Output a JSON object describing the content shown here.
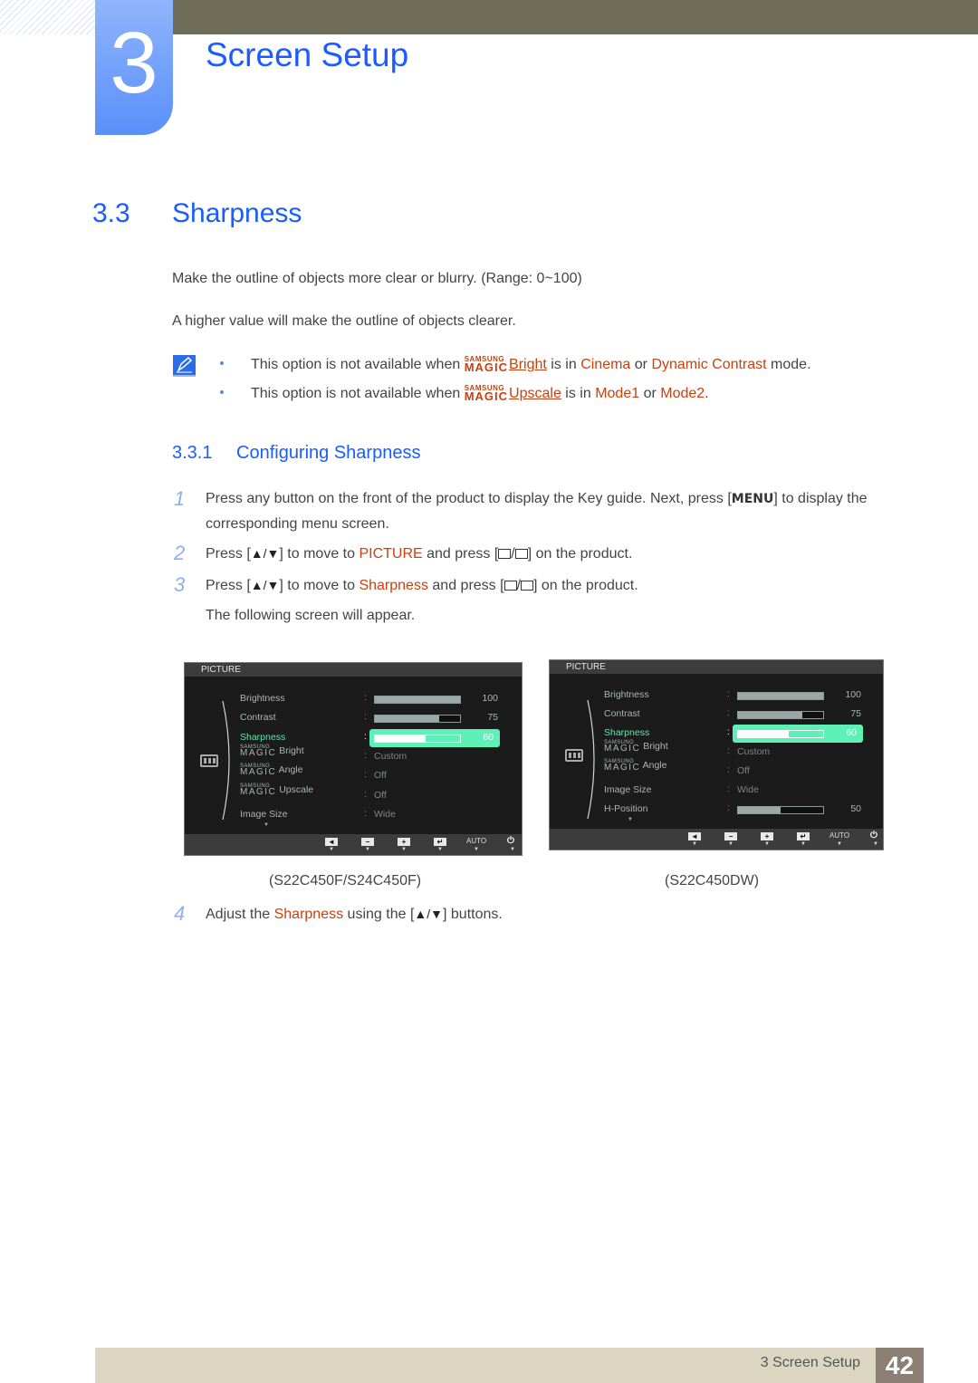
{
  "header": {
    "chapter_number": "3",
    "chapter_title": "Screen Setup"
  },
  "section": {
    "number": "3.3",
    "title": "Sharpness",
    "description": "Make the outline of objects more clear or blurry. (Range: 0~100)",
    "description2": "A higher value will make the outline of objects clearer."
  },
  "notes": [
    {
      "prefix": "This option is not available when ",
      "magic_small": "SAMSUNG",
      "magic_big": "MAGIC",
      "feature": "Bright",
      "mid": " is in ",
      "opt1": "Cinema",
      "or": " or ",
      "opt2": "Dynamic Contrast",
      "suffix": " mode."
    },
    {
      "prefix": "This option is not available when ",
      "magic_small": "SAMSUNG",
      "magic_big": "MAGIC",
      "feature": "Upscale",
      "mid": " is in ",
      "opt1": "Mode1",
      "or": " or ",
      "opt2": "Mode2",
      "suffix": "."
    }
  ],
  "subsection": {
    "number": "3.3.1",
    "title": "Configuring Sharpness"
  },
  "steps": [
    {
      "num": "1",
      "a": "Press any button on the front of the product to display the Key guide. Next, press [",
      "key": "MENU",
      "b": "] to display the corresponding menu screen."
    },
    {
      "num": "2",
      "a": "Press [",
      "arrows": "▲/▼",
      "b": "] to move to ",
      "hl": "PICTURE",
      "c": " and press [",
      "d": "] on the product."
    },
    {
      "num": "3",
      "a": "Press [",
      "arrows": "▲/▼",
      "b": "] to move to ",
      "hl": "Sharpness",
      "c": " and press [",
      "d": "] on the product."
    },
    {
      "follow": "The following screen will appear."
    },
    {
      "num": "4",
      "a": "Adjust the ",
      "hl": "Sharpness",
      "b": " using the [",
      "arrows": "▲/▼",
      "c": "] buttons."
    }
  ],
  "osd_left": {
    "title": "PICTURE",
    "model": "(S22C450F/S24C450F)",
    "items": [
      {
        "label": "Brightness",
        "value": 100,
        "type": "bar"
      },
      {
        "label": "Contrast",
        "value": 75,
        "type": "bar"
      },
      {
        "label": "Sharpness",
        "value": 60,
        "type": "bar",
        "selected": true
      },
      {
        "label": "Bright",
        "magic": true,
        "value": "Custom"
      },
      {
        "label": "Angle",
        "magic": true,
        "value": "Off"
      },
      {
        "label": "Upscale",
        "magic": true,
        "value": "Off"
      },
      {
        "label": "Image Size",
        "value": "Wide"
      }
    ],
    "footer": [
      "◄",
      "−",
      "+",
      "↵",
      "AUTO",
      "⏻"
    ]
  },
  "osd_right": {
    "title": "PICTURE",
    "model": "(S22C450DW)",
    "items": [
      {
        "label": "Brightness",
        "value": 100,
        "type": "bar"
      },
      {
        "label": "Contrast",
        "value": 75,
        "type": "bar"
      },
      {
        "label": "Sharpness",
        "value": 60,
        "type": "bar",
        "selected": true
      },
      {
        "label": "Bright",
        "magic": true,
        "value": "Custom"
      },
      {
        "label": "Angle",
        "magic": true,
        "value": "Off"
      },
      {
        "label": "Image Size",
        "value": "Wide"
      },
      {
        "label": "H-Position",
        "value": 50,
        "type": "bar"
      }
    ],
    "footer": [
      "◄",
      "−",
      "+",
      "↵",
      "AUTO",
      "⏻"
    ]
  },
  "magic_small": "SAMSUNG",
  "magic_big": "MAGIC",
  "footer": {
    "chapter_label": "3 Screen Setup",
    "page_number": "42"
  }
}
